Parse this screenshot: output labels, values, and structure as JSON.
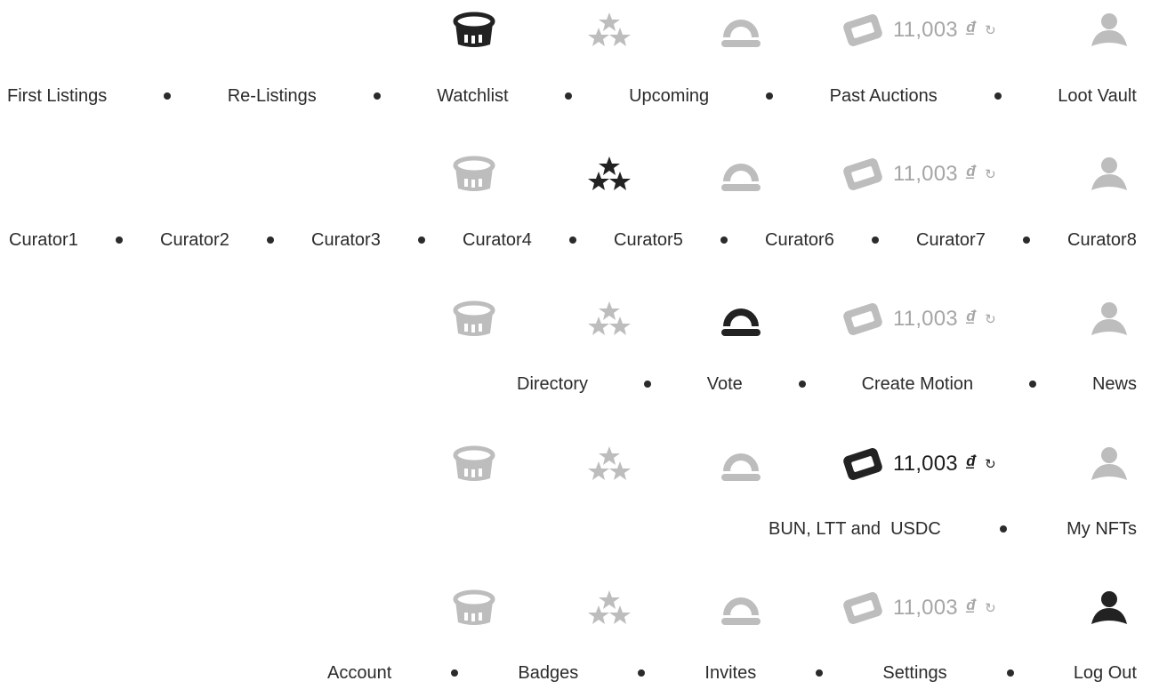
{
  "colors": {
    "active": "#222222",
    "inactive": "#bdbdbd"
  },
  "icons": [
    "auction-basket-icon",
    "stars-icon",
    "governance-dome-icon",
    "wallet-icon",
    "user-icon"
  ],
  "balance": {
    "amount": "11,003",
    "currency": "₫",
    "refresh": "↻"
  },
  "menus": [
    {
      "active": "auction",
      "links": [
        "First Listings",
        "Re-Listings",
        "Watchlist",
        "Upcoming",
        "Past Auctions",
        "Loot Vault"
      ]
    },
    {
      "active": "curators",
      "links": [
        "Curator1",
        "Curator2",
        "Curator3",
        "Curator4",
        "Curator5",
        "Curator6",
        "Curator7",
        "Curator8"
      ]
    },
    {
      "active": "governance",
      "links": [
        "Directory",
        "Vote",
        "Create Motion",
        "News"
      ]
    },
    {
      "active": "wallet",
      "links": [
        "BUN, LTT and  USDC",
        "My NFTs"
      ]
    },
    {
      "active": "profile",
      "links": [
        "Account",
        "Badges",
        "Invites",
        "Settings",
        "Log Out"
      ]
    }
  ]
}
